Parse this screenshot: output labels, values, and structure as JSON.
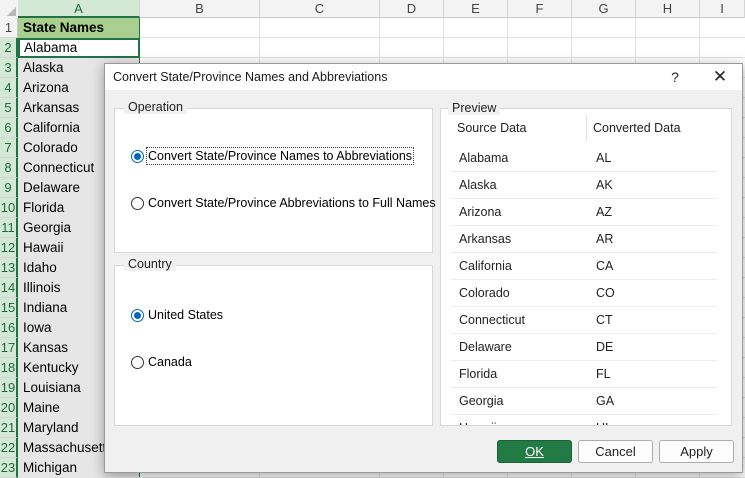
{
  "spreadsheet": {
    "columns": [
      "A",
      "B",
      "C",
      "D",
      "E",
      "F",
      "G",
      "H",
      "I"
    ],
    "rows": [
      "1",
      "2",
      "3",
      "4",
      "5",
      "6",
      "7",
      "8",
      "9",
      "10",
      "11",
      "12",
      "13",
      "14",
      "15",
      "16",
      "17",
      "18",
      "19",
      "20",
      "21",
      "22",
      "23"
    ],
    "column_a": [
      "State Names",
      "Alabama",
      "Alaska",
      "Arizona",
      "Arkansas",
      "California",
      "Colorado",
      "Connecticut",
      "Delaware",
      "Florida",
      "Georgia",
      "Hawaii",
      "Idaho",
      "Illinois",
      "Indiana",
      "Iowa",
      "Kansas",
      "Kentucky",
      "Louisiana",
      "Maine",
      "Maryland",
      "Massachusetts",
      "Michigan"
    ],
    "colors": {
      "header_fill": "#a9d08e",
      "selection": "#217346"
    }
  },
  "dialog": {
    "title": "Convert State/Province Names and Abbreviations",
    "help": "?",
    "close": "✕",
    "operation": {
      "legend": "Operation",
      "options": [
        {
          "label": "Convert State/Province Names to Abbreviations",
          "checked": true
        },
        {
          "label": "Convert State/Province Abbreviations to Full Names",
          "checked": false
        }
      ]
    },
    "country": {
      "legend": "Country",
      "options": [
        {
          "label": "United States",
          "checked": true
        },
        {
          "label": "Canada",
          "checked": false
        }
      ]
    },
    "preview": {
      "legend": "Preview",
      "headers": [
        "Source Data",
        "Converted Data"
      ],
      "rows": [
        [
          "Alabama",
          "AL"
        ],
        [
          "Alaska",
          "AK"
        ],
        [
          "Arizona",
          "AZ"
        ],
        [
          "Arkansas",
          "AR"
        ],
        [
          "California",
          "CA"
        ],
        [
          "Colorado",
          "CO"
        ],
        [
          "Connecticut",
          "CT"
        ],
        [
          "Delaware",
          "DE"
        ],
        [
          "Florida",
          "FL"
        ],
        [
          "Georgia",
          "GA"
        ],
        [
          "Hawaii",
          "HI"
        ]
      ]
    },
    "buttons": {
      "ok": "OK",
      "cancel": "Cancel",
      "apply": "Apply"
    }
  }
}
